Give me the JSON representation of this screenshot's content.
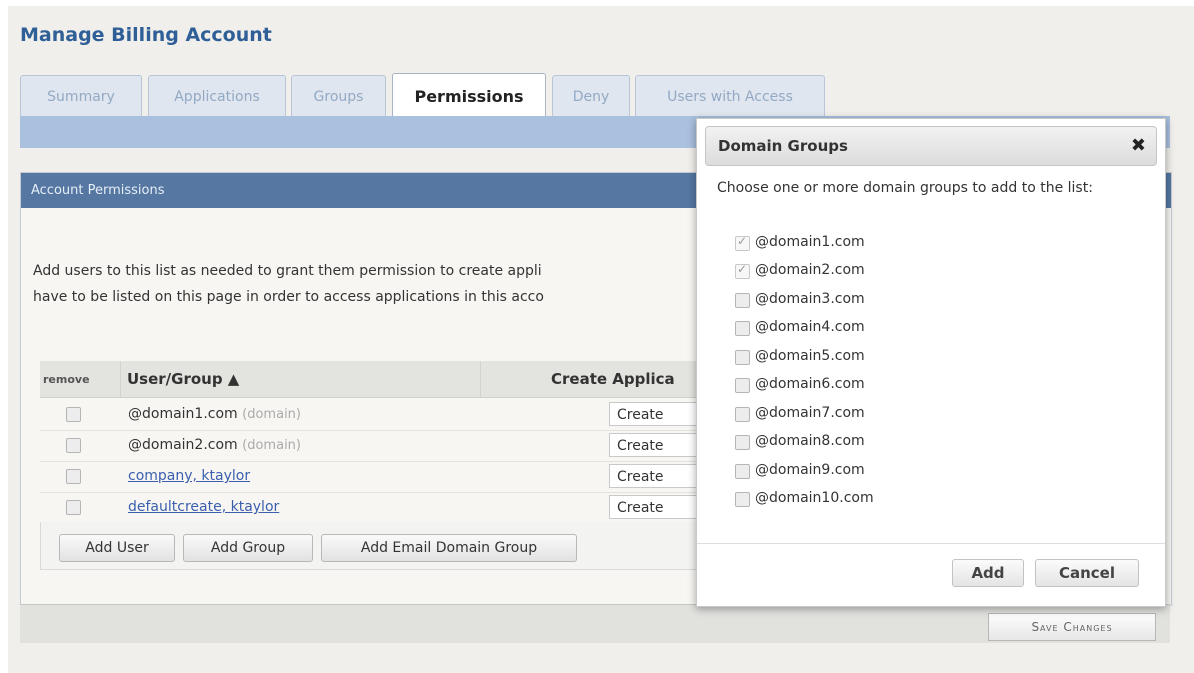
{
  "page": {
    "title": "Manage Billing Account"
  },
  "tabs": [
    {
      "label": "Summary"
    },
    {
      "label": "Applications"
    },
    {
      "label": "Groups"
    },
    {
      "label": "Permissions",
      "active": true
    },
    {
      "label": "Deny"
    },
    {
      "label": "Users with Access"
    }
  ],
  "panel": {
    "header": "Account Permissions",
    "description_line1": "Add users to this list as needed to grant them permission to create appli",
    "description_line2": "have to be listed on this page in order to access applications in this acco"
  },
  "table": {
    "headers": {
      "remove": "remove",
      "user_group": "User/Group ▲",
      "create_apps": "Create Applica"
    },
    "rows": [
      {
        "user": "@domain1.com",
        "tag": "(domain)",
        "is_link": false,
        "create": "Create"
      },
      {
        "user": "@domain2.com",
        "tag": "(domain)",
        "is_link": false,
        "create": "Create"
      },
      {
        "user": "company, ktaylor",
        "tag": "",
        "is_link": true,
        "create": "Create"
      },
      {
        "user": "defaultcreate, ktaylor",
        "tag": "",
        "is_link": true,
        "create": "Create"
      }
    ]
  },
  "buttons": {
    "add_user": "Add User",
    "add_group": "Add Group",
    "add_email_domain_group": "Add Email Domain Group",
    "save_changes": "Save Changes"
  },
  "dialog": {
    "title": "Domain Groups",
    "close_icon": "close-icon",
    "prompt": "Choose one or more domain groups to add to the list:",
    "domains": [
      {
        "label": "@domain1.com",
        "checked": true
      },
      {
        "label": "@domain2.com",
        "checked": true
      },
      {
        "label": "@domain3.com",
        "checked": false
      },
      {
        "label": "@domain4.com",
        "checked": false
      },
      {
        "label": "@domain5.com",
        "checked": false
      },
      {
        "label": "@domain6.com",
        "checked": false
      },
      {
        "label": "@domain7.com",
        "checked": false
      },
      {
        "label": "@domain8.com",
        "checked": false
      },
      {
        "label": "@domain9.com",
        "checked": false
      },
      {
        "label": "@domain10.com",
        "checked": false
      }
    ],
    "add_label": "Add",
    "cancel_label": "Cancel"
  },
  "colors": {
    "title": "#2e5f97",
    "panel_header": "#5577a2",
    "tab_bar": "#a9c0de",
    "link": "#3b5fae"
  }
}
